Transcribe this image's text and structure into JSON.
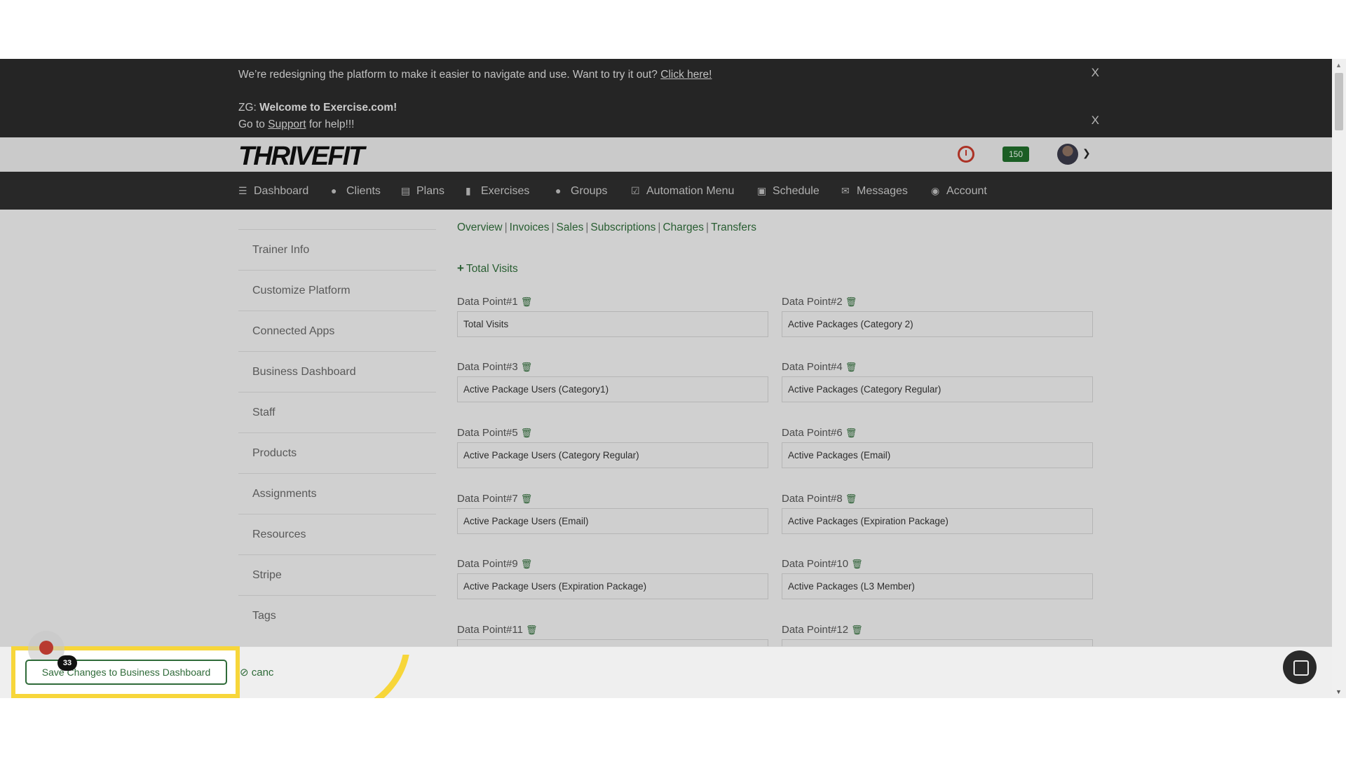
{
  "banner": {
    "line1_text": "We’re redesigning the platform to make it easier to navigate and use. Want to try it out?",
    "line1_link": "Click here!",
    "close_label": "X",
    "line2_prefix": "ZG:",
    "line2_bold": "Welcome to Exercise.com!",
    "line3_prefix": "Go to",
    "line3_link": "Support",
    "line3_suffix": "for help!!!"
  },
  "brand": {
    "logo_thrive": "THRIVE",
    "logo_fit": "FIT",
    "points_badge": "150"
  },
  "nav": {
    "items": [
      {
        "label": "Dashboard",
        "icon": "list-icon"
      },
      {
        "label": "Clients",
        "icon": "user-icon"
      },
      {
        "label": "Plans",
        "icon": "clipboard-icon"
      },
      {
        "label": "Exercises",
        "icon": "dumbbell-icon"
      },
      {
        "label": "Groups",
        "icon": "users-icon"
      },
      {
        "label": "Automation Menu",
        "icon": "check-square-icon"
      },
      {
        "label": "Schedule",
        "icon": "book-icon"
      },
      {
        "label": "Messages",
        "icon": "envelope-icon"
      },
      {
        "label": "Account",
        "icon": "user-circle-icon"
      }
    ]
  },
  "sidebar": {
    "items": [
      {
        "label": "Trainer Info"
      },
      {
        "label": "Customize Platform"
      },
      {
        "label": "Connected Apps"
      },
      {
        "label": "Business Dashboard"
      },
      {
        "label": "Staff"
      },
      {
        "label": "Products"
      },
      {
        "label": "Assignments"
      },
      {
        "label": "Resources"
      },
      {
        "label": "Stripe"
      },
      {
        "label": "Tags"
      }
    ]
  },
  "subnav": {
    "links": [
      "Overview",
      "Invoices",
      "Sales",
      "Subscriptions",
      "Charges",
      "Transfers"
    ],
    "separator": "|"
  },
  "add_link": {
    "label": "Total Visits"
  },
  "data_points": [
    {
      "label": "Data Point#1",
      "value": "Total Visits"
    },
    {
      "label": "Data Point#2",
      "value": "Active Packages (Category 2)"
    },
    {
      "label": "Data Point#3",
      "value": "Active Package Users (Category1)"
    },
    {
      "label": "Data Point#4",
      "value": "Active Packages (Category Regular)"
    },
    {
      "label": "Data Point#5",
      "value": "Active Package Users (Category Regular)"
    },
    {
      "label": "Data Point#6",
      "value": "Active Packages (Email)"
    },
    {
      "label": "Data Point#7",
      "value": "Active Package Users (Email)"
    },
    {
      "label": "Data Point#8",
      "value": "Active Packages (Expiration Package)"
    },
    {
      "label": "Data Point#9",
      "value": "Active Package Users (Expiration Package)"
    },
    {
      "label": "Data Point#10",
      "value": "Active Packages (L3 Member)"
    },
    {
      "label": "Data Point#11",
      "value": ""
    },
    {
      "label": "Data Point#12",
      "value": ""
    }
  ],
  "footer": {
    "save_label": "Save Changes to Business Dashboard",
    "cancel_label": "canc",
    "notification_count": "33"
  },
  "colors": {
    "accent_green": "#2f6b39",
    "highlight_yellow": "#f7d63a",
    "nav_bg": "#2e2e2e"
  }
}
